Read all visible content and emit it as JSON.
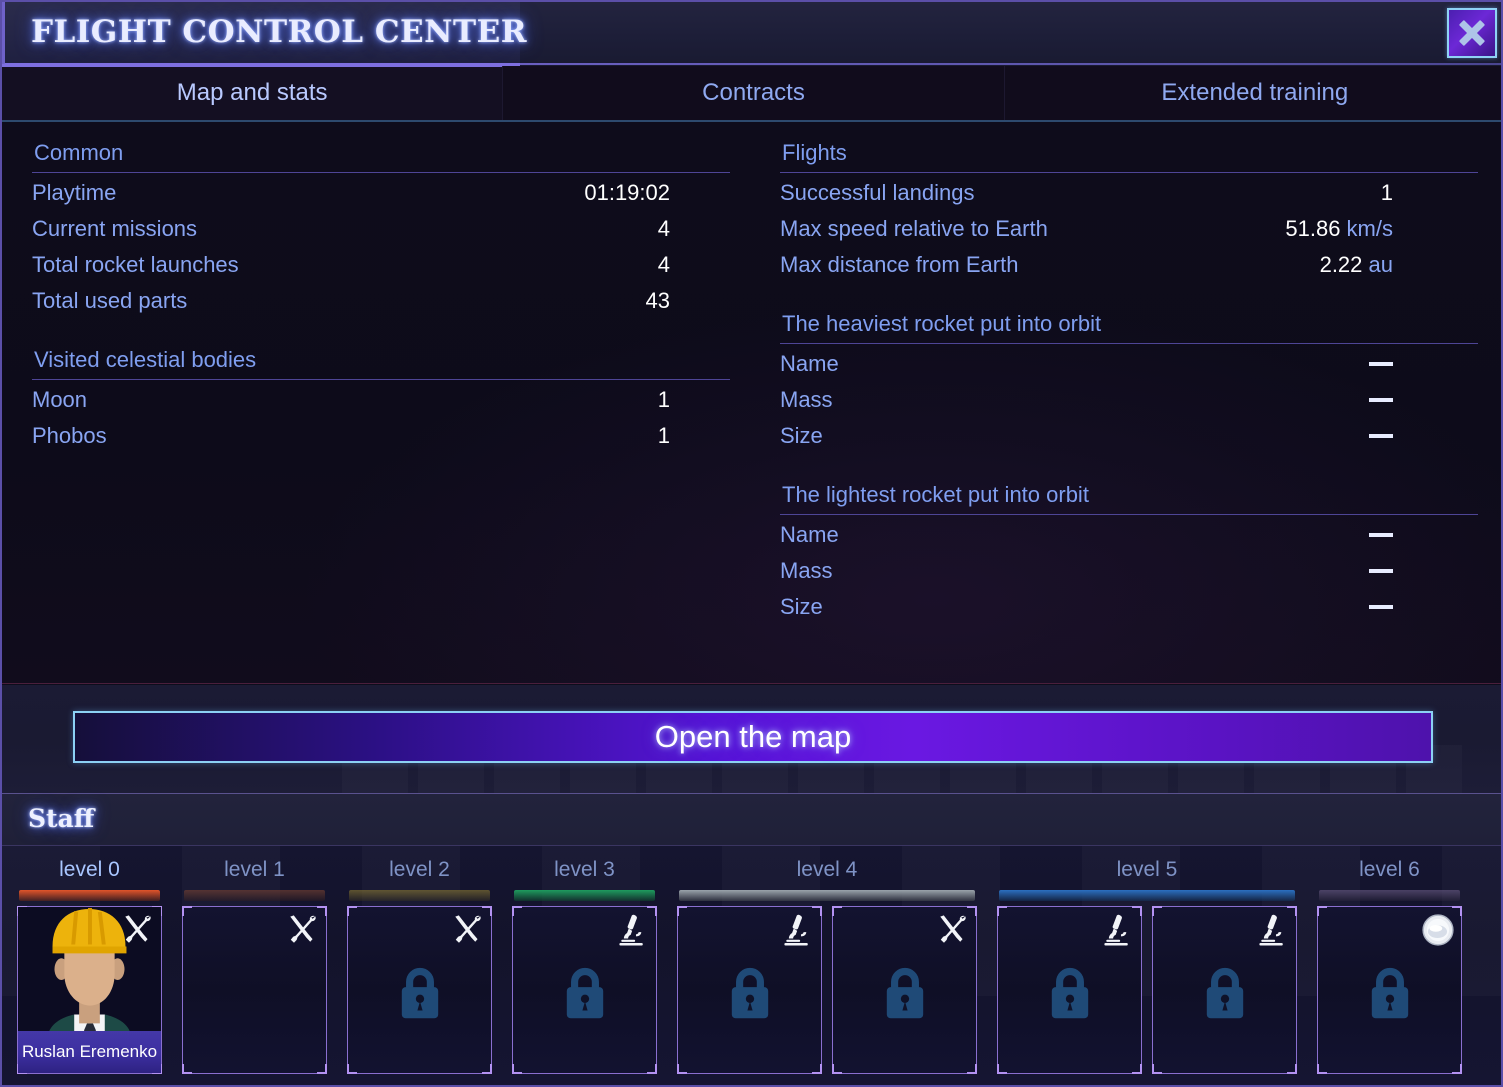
{
  "window": {
    "title": "FLIGHT CONTROL CENTER",
    "close_icon": "close-icon"
  },
  "tabs": [
    {
      "label": "Map and stats",
      "active": true
    },
    {
      "label": "Contracts",
      "active": false
    },
    {
      "label": "Extended training",
      "active": false
    }
  ],
  "stats": {
    "left_sections": [
      {
        "title": "Common",
        "rows": [
          {
            "label": "Playtime",
            "value": "01:19:02"
          },
          {
            "label": "Current missions",
            "value": "4"
          },
          {
            "label": "Total rocket launches",
            "value": "4"
          },
          {
            "label": "Total used parts",
            "value": "43"
          }
        ]
      },
      {
        "title": "Visited celestial bodies",
        "rows": [
          {
            "label": "Moon",
            "value": "1"
          },
          {
            "label": "Phobos",
            "value": "1"
          }
        ]
      }
    ],
    "right_sections": [
      {
        "title": "Flights",
        "rows": [
          {
            "label": "Successful landings",
            "value": "1",
            "unit": ""
          },
          {
            "label": "Max speed relative to Earth",
            "value": "51.86",
            "unit": "km/s"
          },
          {
            "label": "Max distance from Earth",
            "value": "2.22",
            "unit": "au"
          }
        ]
      },
      {
        "title": "The heaviest rocket put into orbit",
        "rows": [
          {
            "label": "Name",
            "value": "—"
          },
          {
            "label": "Mass",
            "value": "—"
          },
          {
            "label": "Size",
            "value": "—"
          }
        ]
      },
      {
        "title": "The lightest rocket put into orbit",
        "rows": [
          {
            "label": "Name",
            "value": "—"
          },
          {
            "label": "Mass",
            "value": "—"
          },
          {
            "label": "Size",
            "value": "—"
          }
        ]
      }
    ]
  },
  "open_map_button": {
    "label": "Open the map"
  },
  "staff": {
    "header": "Staff",
    "levels": [
      {
        "label": "level 0",
        "bar_color": "#e0542a",
        "bar_dim": false,
        "cards": [
          {
            "locked": false,
            "role_icon": "wrench-screwdriver-icon",
            "name": "Ruslan Eremenko",
            "avatar": "engineer-avatar"
          }
        ]
      },
      {
        "label": "level 1",
        "bar_color": "#7a4332",
        "bar_dim": true,
        "cards": [
          {
            "locked": false,
            "role_icon": "wrench-screwdriver-icon",
            "name": "",
            "avatar": ""
          }
        ]
      },
      {
        "label": "level 2",
        "bar_color": "#8b7a32",
        "bar_dim": true,
        "cards": [
          {
            "locked": true,
            "role_icon": "wrench-screwdriver-icon",
            "name": "",
            "avatar": ""
          }
        ]
      },
      {
        "label": "level 3",
        "bar_color": "#1f9b5e",
        "bar_dim": false,
        "cards": [
          {
            "locked": true,
            "role_icon": "microscope-icon",
            "name": "",
            "avatar": ""
          }
        ]
      },
      {
        "label": "level 4",
        "bar_color": "#9aa3ab",
        "bar_dim": false,
        "cards": [
          {
            "locked": true,
            "role_icon": "microscope-icon",
            "name": "",
            "avatar": ""
          },
          {
            "locked": true,
            "role_icon": "wrench-screwdriver-icon",
            "name": "",
            "avatar": ""
          }
        ]
      },
      {
        "label": "level 5",
        "bar_color": "#2b6fc0",
        "bar_dim": false,
        "cards": [
          {
            "locked": true,
            "role_icon": "microscope-icon",
            "name": "",
            "avatar": ""
          },
          {
            "locked": true,
            "role_icon": "microscope-icon",
            "name": "",
            "avatar": ""
          }
        ]
      },
      {
        "label": "level 6",
        "bar_color": "#6b5c86",
        "bar_dim": true,
        "cards": [
          {
            "locked": true,
            "role_icon": "astronaut-helmet-icon",
            "name": "",
            "avatar": ""
          }
        ]
      }
    ]
  },
  "colors": {
    "accent_purple": "#7e6fe0",
    "label_blue": "#89a5f2",
    "value_white": "#ffffff",
    "lock_blue": "#1f4a77",
    "button_glow": "#8cd0f4"
  }
}
